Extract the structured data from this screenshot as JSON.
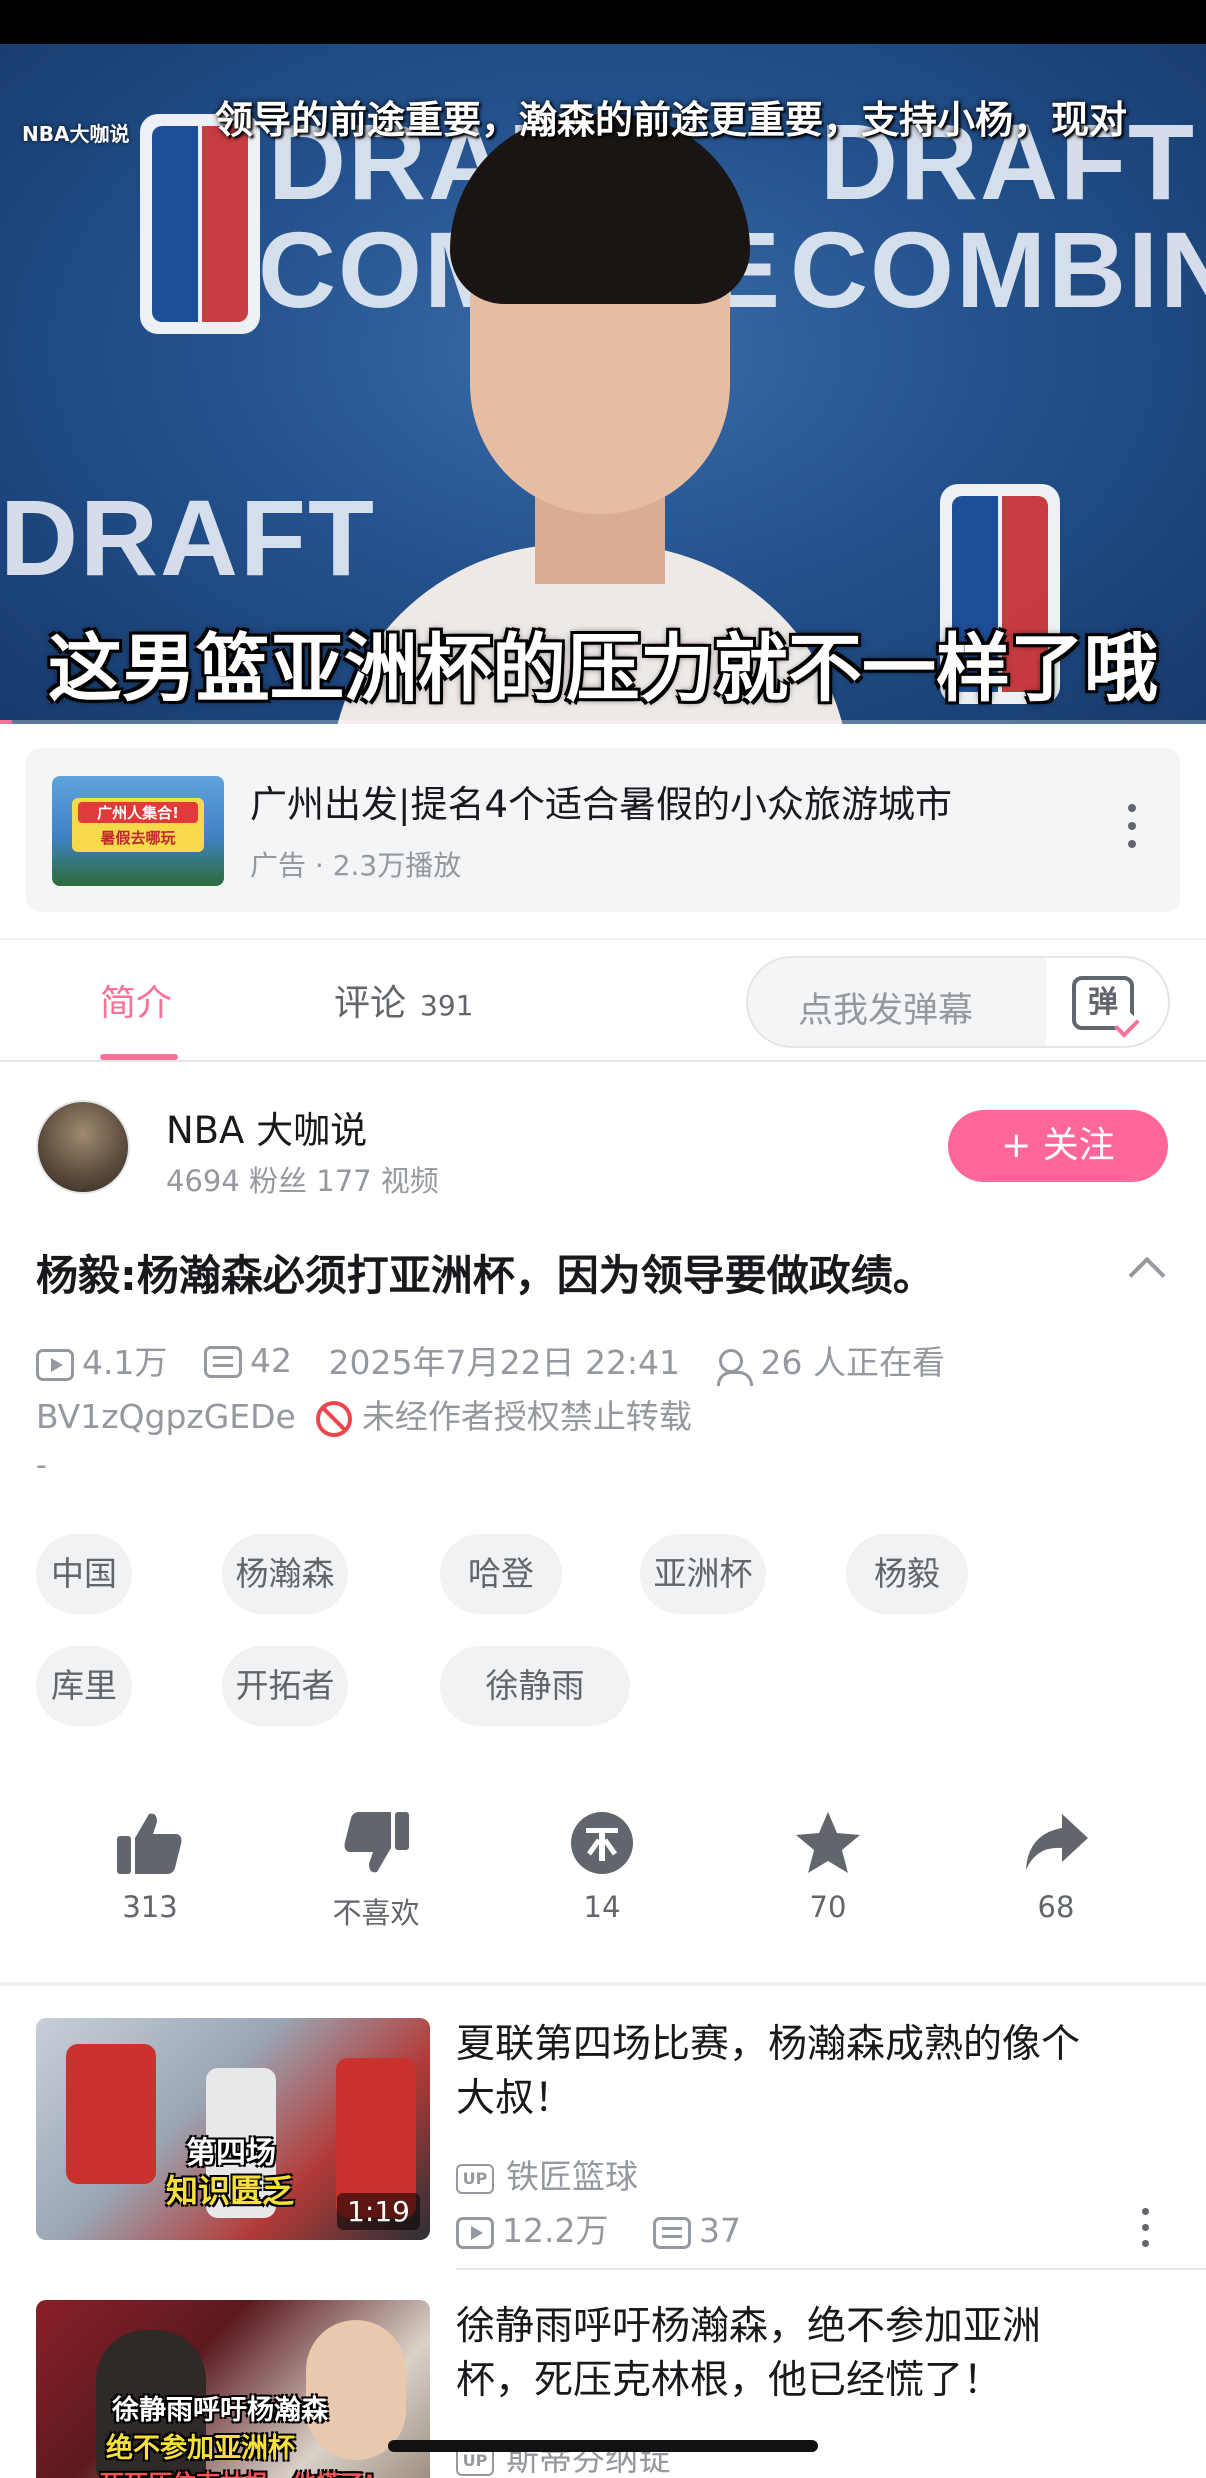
{
  "player": {
    "channel_watermark": "NBA大咖说",
    "danmaku_line": "领导的前途重要，瀚森的前途更重要，支持小杨，现对",
    "subtitle": "这男篮亚洲杯的压力就不一样了哦",
    "backdrop_text_1": "DRAFT",
    "backdrop_text_2": "COMBINE",
    "progress_fraction": 0.01
  },
  "ad": {
    "thumb_text": "暑假去哪玩",
    "thumb_top": "广州人集合!",
    "title": "广州出发|提名4个适合暑假的小众旅游城市",
    "meta": "广告 · 2.3万播放"
  },
  "tabs": {
    "intro": "简介",
    "comments": "评论",
    "comments_count": "391",
    "danmaku_placeholder": "点我发弹幕",
    "danmaku_icon_char": "弹"
  },
  "uploader": {
    "name": "NBA 大咖说",
    "stats": "4694 粉丝   177 视频",
    "follow_label": "+ 关注"
  },
  "video": {
    "title": "杨毅:杨瀚森必须打亚洲杯，因为领导要做政绩。",
    "views": "4.1万",
    "danmaku_count": "42",
    "date": "2025年7月22日 22:41",
    "watching": "26 人正在看",
    "bvid": "BV1zQgpzGEDe",
    "copyright": "未经作者授权禁止转载",
    "description": "-"
  },
  "tags": [
    "中国",
    "杨瀚森",
    "哈登",
    "亚洲杯",
    "杨毅",
    "库里",
    "开拓者",
    "徐静雨"
  ],
  "actions": {
    "like": "313",
    "dislike": "不喜欢",
    "coin": "14",
    "favorite": "70",
    "share": "68"
  },
  "recommendations": [
    {
      "title": "夏联第四场比赛，杨瀚森成熟的像个大叔！",
      "uploader": "铁匠篮球",
      "views": "12.2万",
      "danmaku": "37",
      "duration": "1:19",
      "thumb_caption_1": "第四场",
      "thumb_caption_2": "知识匮乏"
    },
    {
      "title": "徐静雨呼吁杨瀚森，绝不参加亚洲杯，死压克林根，他已经慌了！",
      "uploader": "斯蒂芬纳锭",
      "thumb_caption_1": "徐静雨呼吁杨瀚森",
      "thumb_caption_2": "绝不参加亚洲杯",
      "thumb_caption_3": "死死压住克林根，他慌了!"
    }
  ],
  "colors": {
    "accent": "#fb7299",
    "follow": "#ff6699",
    "text_secondary": "#9499a0",
    "warning": "#f0444d"
  }
}
